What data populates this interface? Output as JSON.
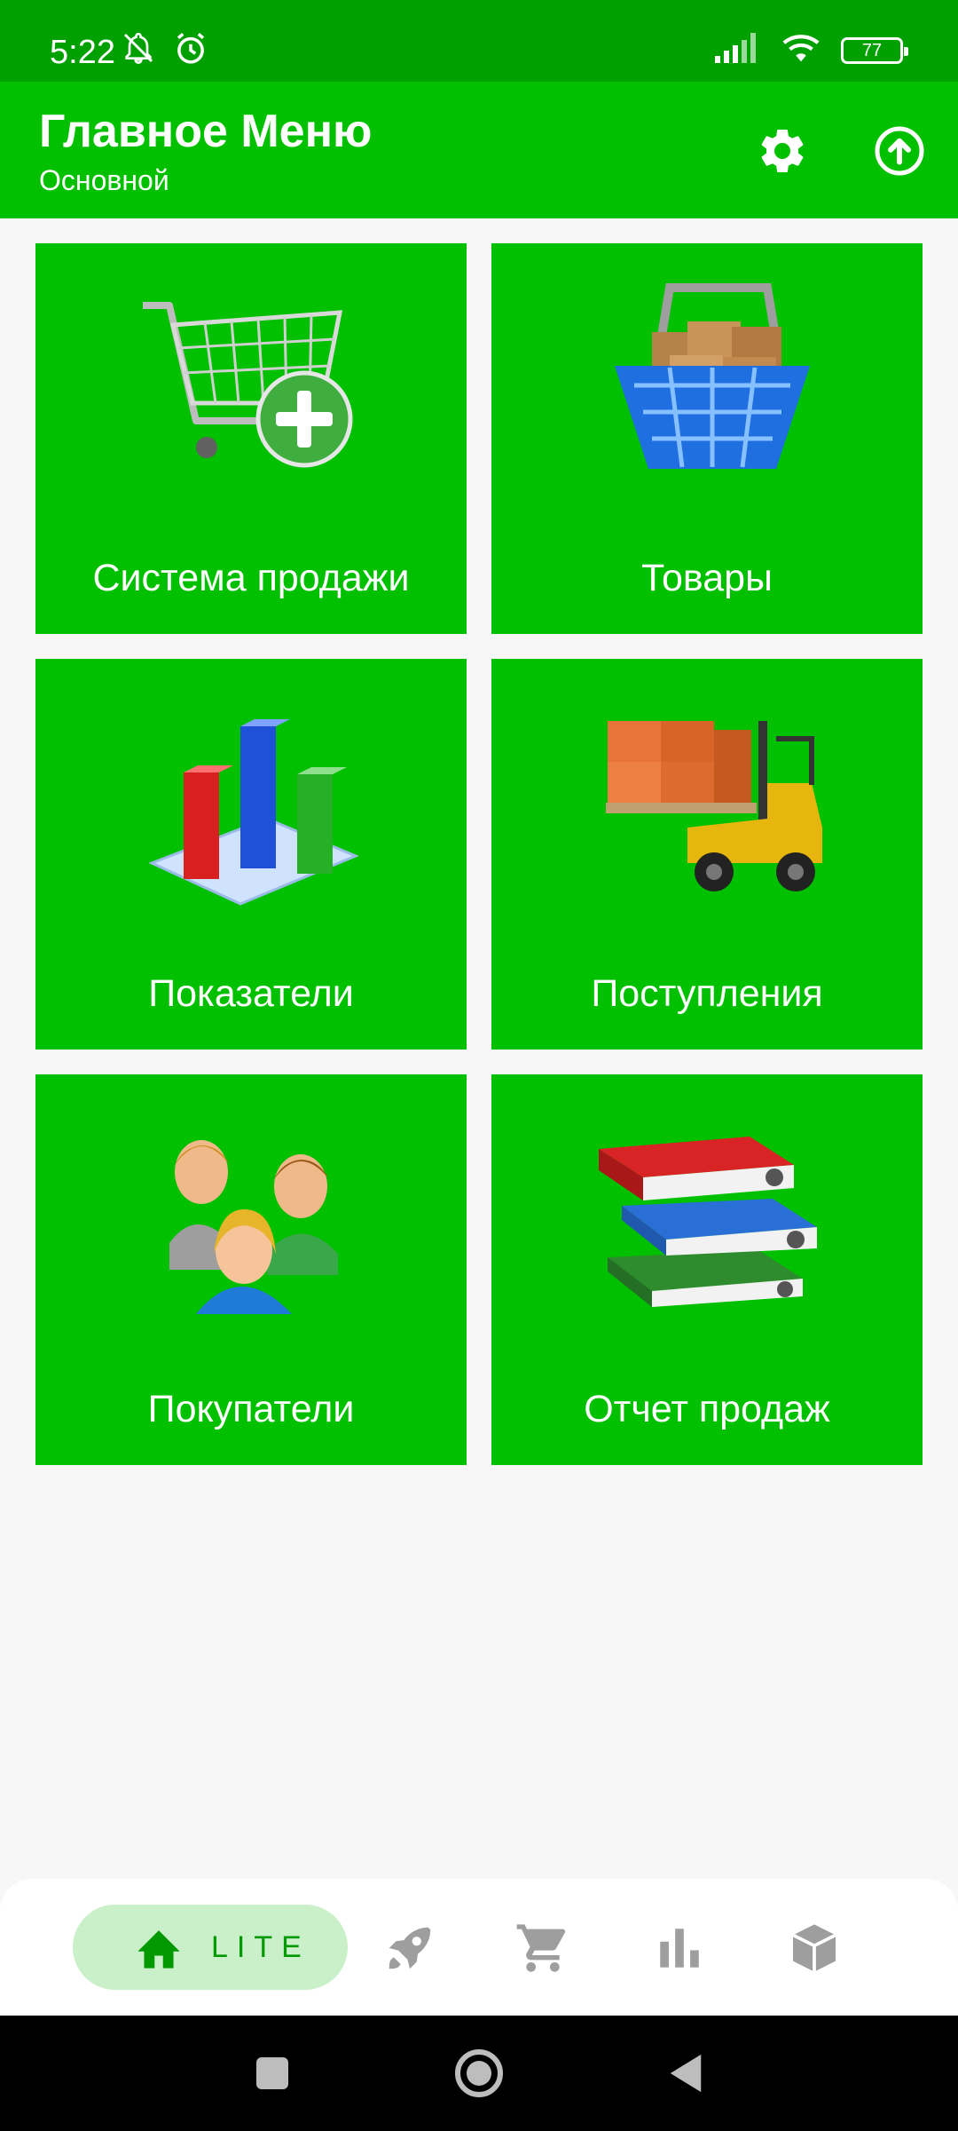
{
  "status_bar": {
    "time": "5:22",
    "battery": "77",
    "icons": [
      "notifications-off-icon",
      "alarm-icon",
      "signal-icon",
      "wifi-icon",
      "battery-icon"
    ]
  },
  "appbar": {
    "title": "Главное Меню",
    "subtitle": "Основной",
    "actions": [
      "settings-icon",
      "upload-icon"
    ]
  },
  "tiles": [
    {
      "label": "Система продажи",
      "icon": "shopping-cart-add-icon"
    },
    {
      "label": "Товары",
      "icon": "basket-boxes-icon"
    },
    {
      "label": "Показатели",
      "icon": "bar-chart-icon"
    },
    {
      "label": "Поступления",
      "icon": "forklift-icon"
    },
    {
      "label": "Покупатели",
      "icon": "customers-icon"
    },
    {
      "label": "Отчет продаж",
      "icon": "binders-icon"
    }
  ],
  "bottom_nav": {
    "active_label": "LITE",
    "items": [
      "home-icon",
      "rocket-icon",
      "cart-icon",
      "chart-icon",
      "box-icon"
    ]
  },
  "colors": {
    "status_bar": "#00a000",
    "primary": "#00c000",
    "background": "#f7f7f7",
    "nav_active_bg": "#c9f0c9",
    "nav_active_fg": "#009900",
    "nav_inactive": "#9e9e9e"
  }
}
